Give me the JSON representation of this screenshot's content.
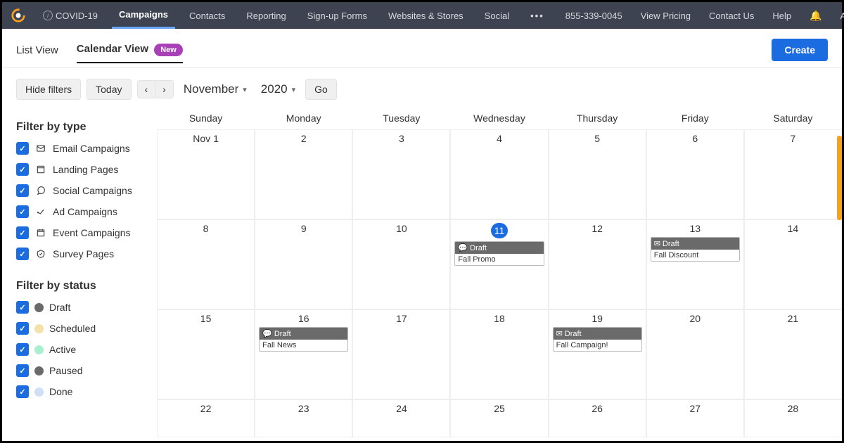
{
  "topnav": {
    "covid": "COVID-19",
    "items": [
      "Campaigns",
      "Contacts",
      "Reporting",
      "Sign-up Forms",
      "Websites & Stores",
      "Social"
    ],
    "active": "Campaigns",
    "phone": "855-339-0045",
    "rightItems": [
      "View Pricing",
      "Contact Us",
      "Help"
    ],
    "user": "Anna"
  },
  "viewbar": {
    "list": "List View",
    "calendar": "Calendar View",
    "newBadge": "New",
    "create": "Create"
  },
  "toolbar": {
    "hide": "Hide filters",
    "today": "Today",
    "month": "November",
    "year": "2020",
    "go": "Go"
  },
  "filters": {
    "typeHeading": "Filter by type",
    "types": [
      {
        "label": "Email Campaigns",
        "icon": "mail"
      },
      {
        "label": "Landing Pages",
        "icon": "page"
      },
      {
        "label": "Social Campaigns",
        "icon": "chat"
      },
      {
        "label": "Ad Campaigns",
        "icon": "ad"
      },
      {
        "label": "Event Campaigns",
        "icon": "event"
      },
      {
        "label": "Survey Pages",
        "icon": "survey"
      }
    ],
    "statusHeading": "Filter by status",
    "statuses": [
      {
        "label": "Draft",
        "color": "#6a6a6a"
      },
      {
        "label": "Scheduled",
        "color": "#f4e0a8"
      },
      {
        "label": "Active",
        "color": "#a8f0cf"
      },
      {
        "label": "Paused",
        "color": "#6a6a6a"
      },
      {
        "label": "Done",
        "color": "#cfe0f6"
      }
    ]
  },
  "calendar": {
    "days": [
      "Sunday",
      "Monday",
      "Tuesday",
      "Wednesday",
      "Thursday",
      "Friday",
      "Saturday"
    ],
    "weeks": [
      [
        "Nov 1",
        "2",
        "3",
        "4",
        "5",
        "6",
        "7"
      ],
      [
        "8",
        "9",
        "10",
        "11",
        "12",
        "13",
        "14"
      ],
      [
        "15",
        "16",
        "17",
        "18",
        "19",
        "20",
        "21"
      ],
      [
        "22",
        "23",
        "24",
        "25",
        "26",
        "27",
        "28"
      ]
    ],
    "today": "11",
    "events": {
      "11": [
        {
          "status": "Draft",
          "title": "Fall Promo",
          "icon": "chat"
        }
      ],
      "13": [
        {
          "status": "Draft",
          "title": "Fall Discount",
          "icon": "mail"
        }
      ],
      "16": [
        {
          "status": "Draft",
          "title": "Fall News",
          "icon": "chat"
        }
      ],
      "19": [
        {
          "status": "Draft",
          "title": "Fall Campaign!",
          "icon": "mail"
        }
      ]
    }
  }
}
